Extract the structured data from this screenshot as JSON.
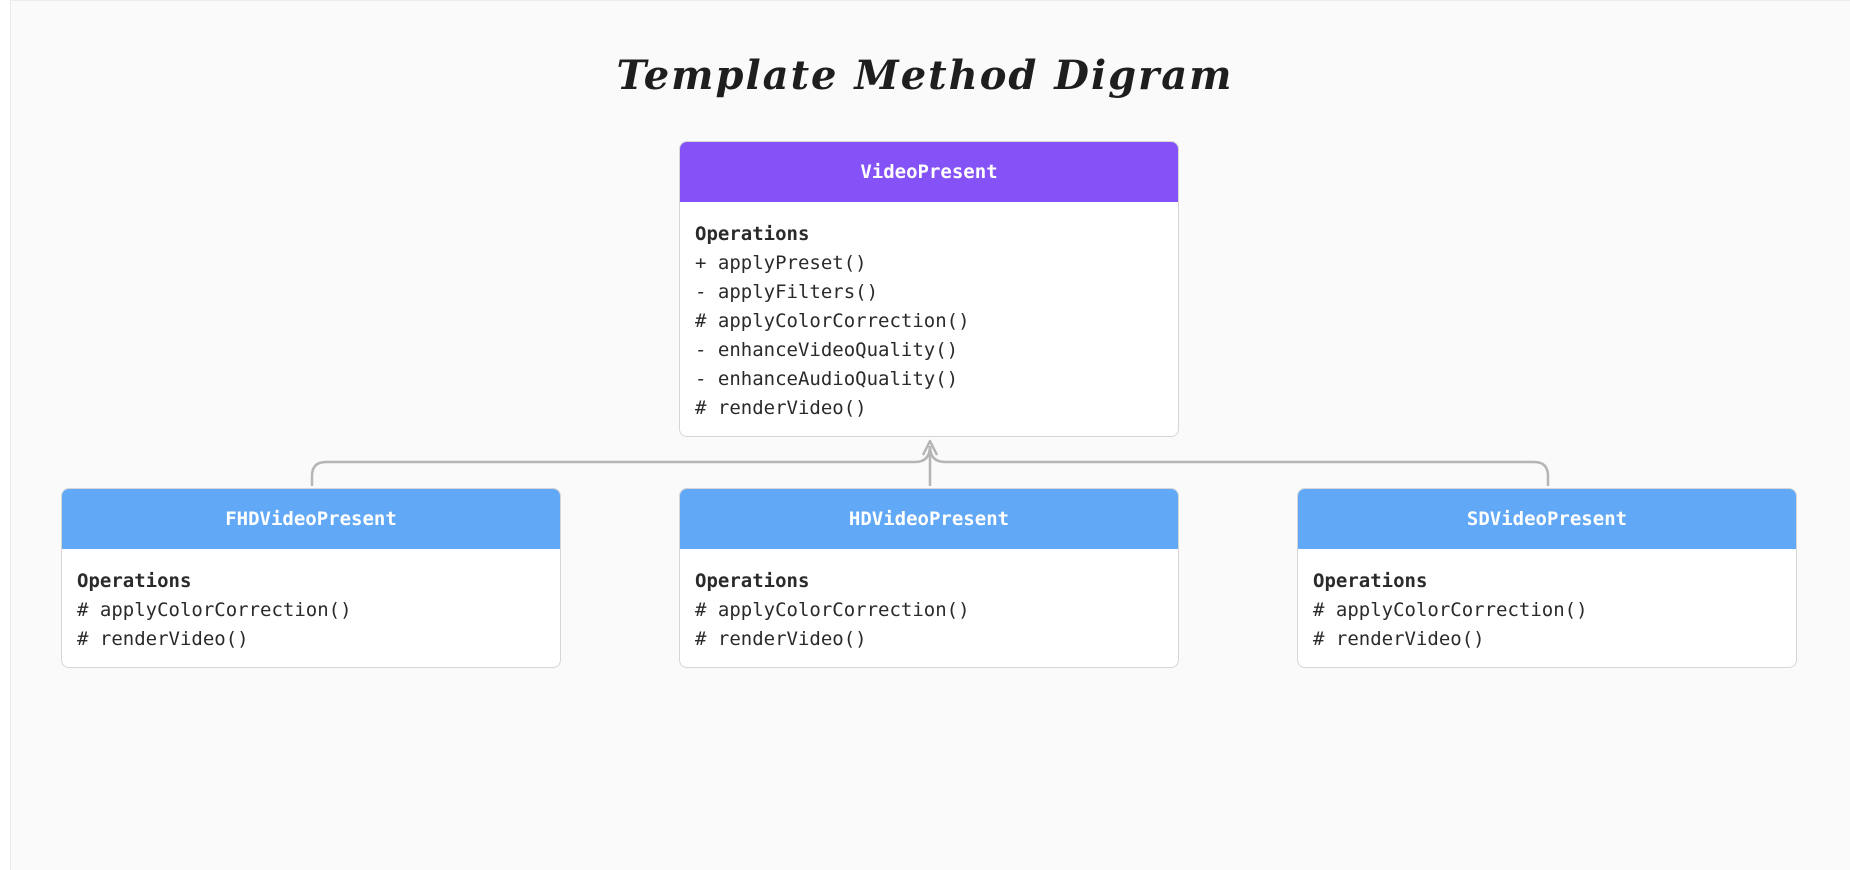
{
  "title": "Template Method Digram",
  "colors": {
    "abstract_header": "#8452f7",
    "concrete_header": "#61a8f6",
    "connector": "#b5b5b5"
  },
  "parent_class": {
    "name": "VideoPresent",
    "section_label": "Operations",
    "operations": [
      "+ applyPreset()",
      "- applyFilters()",
      "# applyColorCorrection()",
      "- enhanceVideoQuality()",
      "- enhanceAudioQuality()",
      "# renderVideo()"
    ]
  },
  "child_classes": [
    {
      "name": "FHDVideoPresent",
      "section_label": "Operations",
      "operations": [
        "# applyColorCorrection()",
        "# renderVideo()"
      ]
    },
    {
      "name": "HDVideoPresent",
      "section_label": "Operations",
      "operations": [
        "# applyColorCorrection()",
        "# renderVideo()"
      ]
    },
    {
      "name": "SDVideoPresent",
      "section_label": "Operations",
      "operations": [
        "# applyColorCorrection()",
        "# renderVideo()"
      ]
    }
  ]
}
